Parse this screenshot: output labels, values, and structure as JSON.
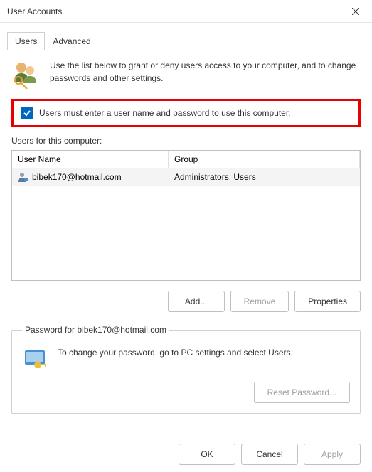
{
  "window": {
    "title": "User Accounts"
  },
  "tabs": {
    "users": "Users",
    "advanced": "Advanced"
  },
  "intro": "Use the list below to grant or deny users access to your computer, and to change passwords and other settings.",
  "requireLogin": {
    "label": "Users must enter a user name and password to use this computer.",
    "checked": true
  },
  "usersListLabel": "Users for this computer:",
  "table": {
    "headers": {
      "name": "User Name",
      "group": "Group"
    },
    "rows": [
      {
        "name": "bibek170@hotmail.com",
        "group": "Administrators; Users"
      }
    ]
  },
  "buttons": {
    "add": "Add...",
    "remove": "Remove",
    "properties": "Properties",
    "resetPassword": "Reset Password...",
    "ok": "OK",
    "cancel": "Cancel",
    "apply": "Apply"
  },
  "passwordSection": {
    "title": "Password for bibek170@hotmail.com",
    "text": "To change your password, go to PC settings and select Users."
  }
}
